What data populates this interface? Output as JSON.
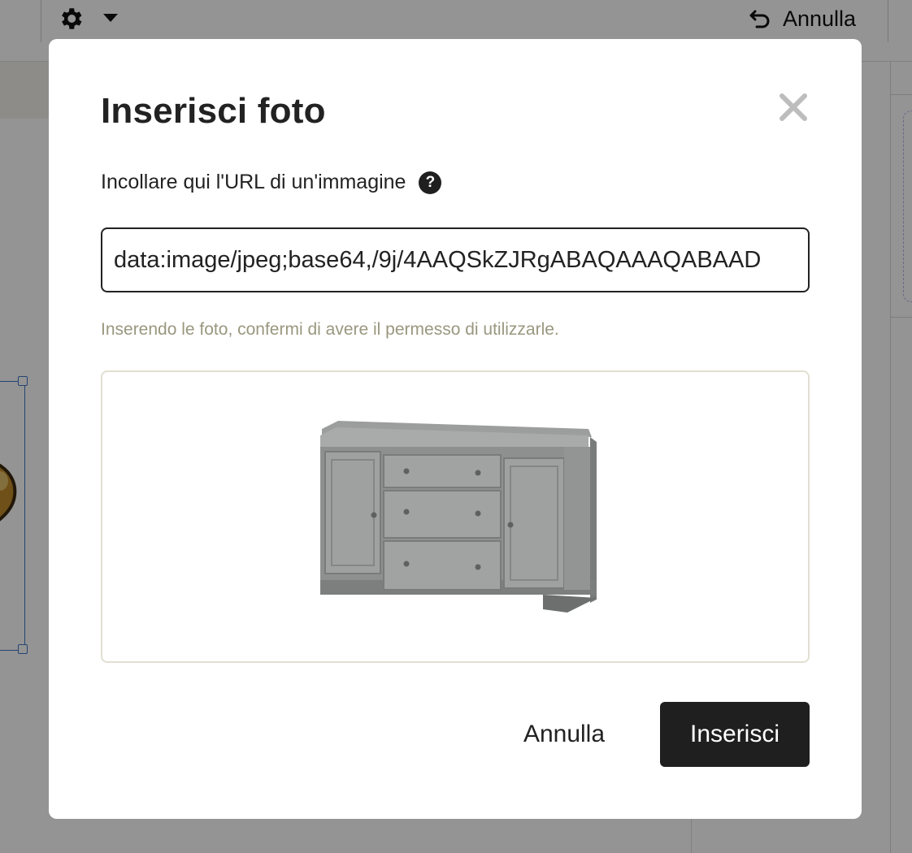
{
  "toolbar": {
    "settings_icon": "gear-icon",
    "dropdown_icon": "caret-down-icon",
    "undo_icon": "undo-icon",
    "undo_label": "Annulla"
  },
  "dialog": {
    "title": "Inserisci foto",
    "close_icon": "close-icon",
    "url_label": "Incollare qui l'URL di un'immagine",
    "help_icon": "question-mark-icon",
    "help_glyph": "?",
    "url_value": "data:image/jpeg;base64,/9j/4AAQSkZJRgABAQAAAQABAAD",
    "permission_notice": "Inserendo le foto, confermi di avere il permesso di utilizzarle.",
    "preview_subject": "grey sideboard cabinet",
    "cancel_label": "Annulla",
    "insert_label": "Inserisci"
  },
  "colors": {
    "overlay": "#000000",
    "primary_button": "#1f1f1f",
    "notice_text": "#9a977f",
    "preview_border": "#e1dfd2",
    "selection": "#3f76c4"
  }
}
